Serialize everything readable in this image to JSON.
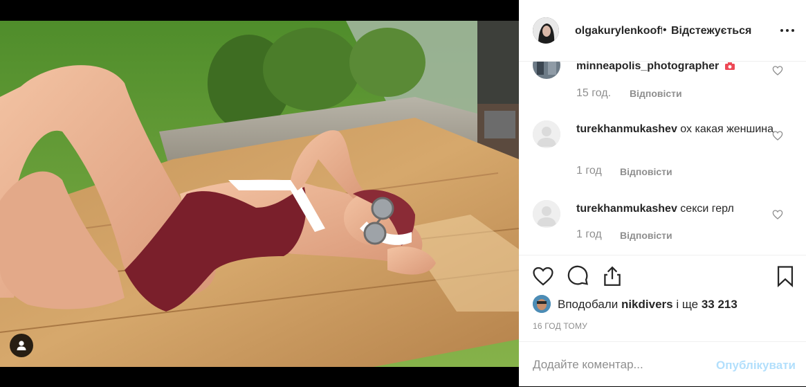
{
  "post": {
    "photo_alt": "",
    "user_tag_icon": "person-icon"
  },
  "header": {
    "username": "olgakurylenkoofficial",
    "username_display": "olgakurylenkooffiи",
    "separator": "•",
    "follow_label": "Відстежується",
    "more_icon": "more-horizontal-icon"
  },
  "comments": [
    {
      "username": "minneapolis_photographer",
      "text": "",
      "badge_icon": "camera-icon",
      "time": "15 год.",
      "reply_label": "Відповісти"
    },
    {
      "username": "turekhanmukashev",
      "text": "ох какая женшина",
      "time": "1 год",
      "reply_label": "Відповісти"
    },
    {
      "username": "turekhanmukashev",
      "text": "секси герл",
      "time": "1 год",
      "reply_label": "Відповісти"
    }
  ],
  "actions": {
    "like_icon": "heart-icon",
    "comment_icon": "comment-icon",
    "share_icon": "share-icon",
    "save_icon": "bookmark-icon"
  },
  "likes": {
    "prefix": "Вподобали ",
    "user": "nikdivers",
    "middle": " і ще ",
    "count": "33 213"
  },
  "timestamp": "16 ГОД ТОМУ",
  "add_comment": {
    "placeholder": "Додайте коментар...",
    "publish_label": "Опублікувати"
  },
  "colors": {
    "accent_disabled": "#b2dffc",
    "muted": "#8e8e8e",
    "text": "#262626",
    "border": "#efefef",
    "camera_badge": "#ed4956"
  }
}
